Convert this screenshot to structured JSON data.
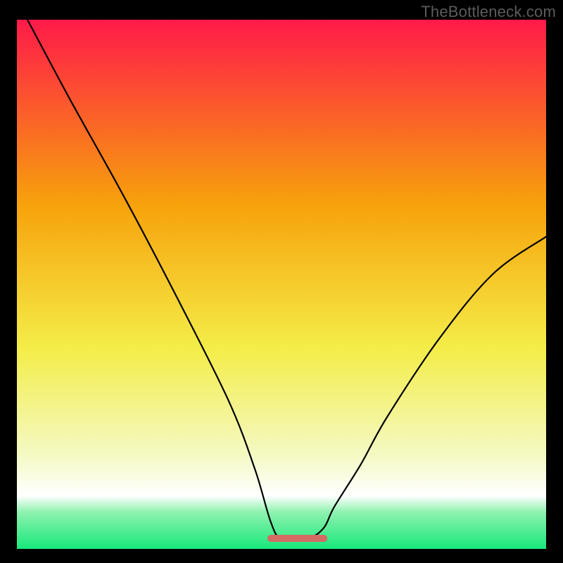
{
  "watermark": "TheBottleneck.com",
  "colors": {
    "background": "#000000",
    "gradient_top": "#ff1a49",
    "gradient_mid": "#f7a20b",
    "gradient_low": "#f4ed48",
    "gradient_pale": "#f4f9c2",
    "gradient_green": "#17e87a",
    "curve": "#000000",
    "flat_segment": "#d46a63",
    "watermark": "#5c5c5c"
  },
  "chart_data": {
    "type": "line",
    "title": "",
    "xlabel": "",
    "ylabel": "",
    "xlim": [
      0,
      100
    ],
    "ylim": [
      0,
      100
    ],
    "grid": false,
    "legend": false,
    "x": [
      2,
      10,
      20,
      30,
      40,
      45,
      48,
      50,
      55,
      58,
      60,
      65,
      70,
      80,
      90,
      100
    ],
    "values": [
      100,
      85,
      67,
      48,
      28,
      15,
      5,
      2,
      2,
      4,
      8,
      16,
      25,
      40,
      52,
      59
    ],
    "flat_segment": {
      "x_start": 48,
      "x_end": 58,
      "y": 2
    },
    "gradient_stops": [
      {
        "offset": 0.0,
        "color": "#ff1a49"
      },
      {
        "offset": 0.35,
        "color": "#f7a20b"
      },
      {
        "offset": 0.62,
        "color": "#f4ed48"
      },
      {
        "offset": 0.82,
        "color": "#f4f9c2"
      },
      {
        "offset": 0.9,
        "color": "#ffffff"
      },
      {
        "offset": 0.93,
        "color": "#8ff2b0"
      },
      {
        "offset": 1.0,
        "color": "#17e87a"
      }
    ]
  }
}
